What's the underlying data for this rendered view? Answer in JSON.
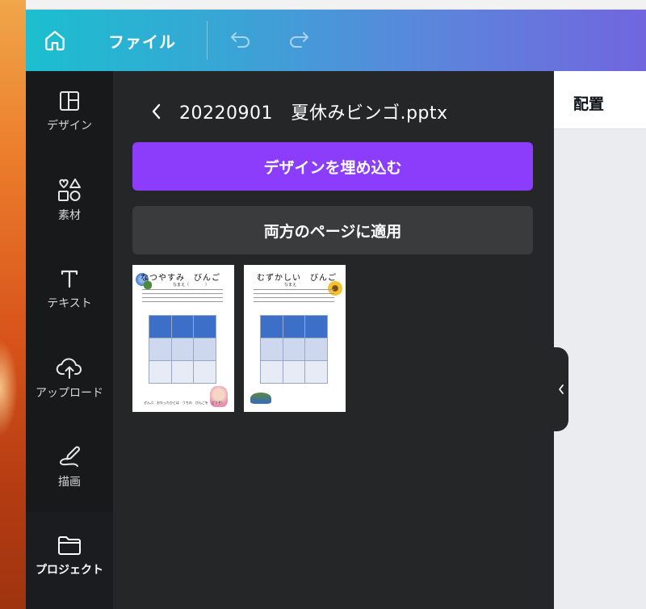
{
  "header": {
    "file_menu": "ファイル"
  },
  "nav": {
    "items": [
      {
        "label": "デザイン"
      },
      {
        "label": "素材"
      },
      {
        "label": "テキスト"
      },
      {
        "label": "アップロード"
      },
      {
        "label": "描画"
      },
      {
        "label": "プロジェクト"
      }
    ]
  },
  "panel": {
    "title": "20220901　夏休みビンゴ.pptx",
    "embed_button": "デザインを埋め込む",
    "apply_button": "両方のページに適用",
    "thumbnails": [
      {
        "title": "なつやすみ　びんご",
        "name_line": "なまえ（　　　　）",
        "footer": "ぜんぶ　おわったひとは　うちの　びんごを　どうぞ！"
      },
      {
        "title": "むずかしい　びんご",
        "name_line": "なまえ",
        "footer": ""
      }
    ]
  },
  "canvas": {
    "position_label": "配置"
  },
  "colors": {
    "embed_accent": "#8b3dfb",
    "header_start": "#1bbfcf",
    "header_end": "#7166de"
  }
}
